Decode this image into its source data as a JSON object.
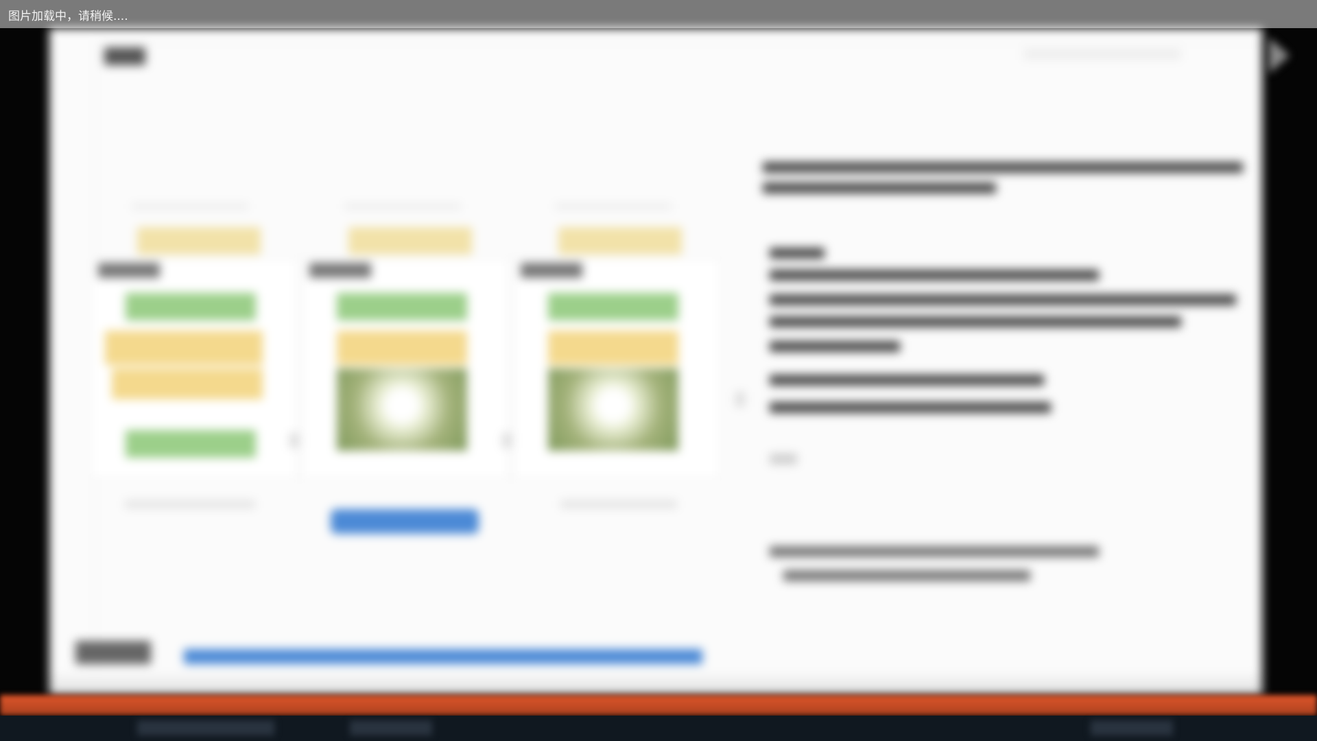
{
  "loading_bar": {
    "text": "图片加载中，请稍候...."
  },
  "viewer": {
    "next_icon": "chevron-right-icon"
  },
  "colors": {
    "accent_blue": "#4c8ad6",
    "green": "#9ccf8a",
    "yellow": "#f4d98d",
    "orange_strip": "#e0562a",
    "top_bar": "#7a7a7a"
  },
  "slide": {
    "feeds": [
      {
        "id": "feed-1"
      },
      {
        "id": "feed-2"
      },
      {
        "id": "feed-3"
      }
    ]
  }
}
